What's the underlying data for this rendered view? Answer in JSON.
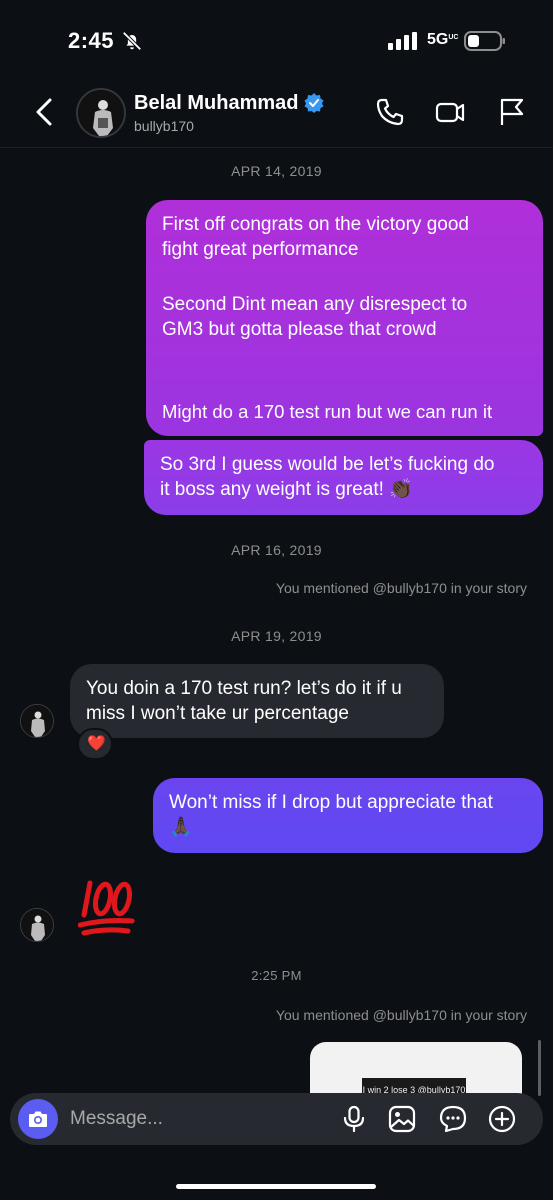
{
  "status_bar": {
    "time": "2:45",
    "network": "5G",
    "network_suffix": "UC"
  },
  "header": {
    "name": "Belal Muhammad",
    "handle": "bullyb170",
    "icons": [
      "back-icon",
      "verified-badge-icon",
      "phone-icon",
      "video-icon",
      "flag-icon"
    ]
  },
  "conversation": {
    "date1": "APR 14, 2019",
    "out1_line1": "First off congrats on the victory good",
    "out1_line2": "fight great performance",
    "out1_line3": "Second Dint mean any disrespect to",
    "out1_line4": "GM3 but gotta please that crowd",
    "out1_line5": "Might do a 170 test run but we can run it",
    "out2_line1": "So 3rd I guess would be let’s fucking do",
    "out2_line2": "it boss any weight is great! 👏🏿",
    "date2": "APR 16, 2019",
    "mention1": "You mentioned @bullyb170 in your story",
    "date3": "APR 19, 2019",
    "in1_line1": "You doin a 170 test run? let’s do it if u",
    "in1_line2": "miss I won’t take ur percentage",
    "reaction": "❤️",
    "out3_line1": "Won’t miss if I drop but appreciate that",
    "out3_line2": "🙏🏿",
    "in2_emoji": "💯",
    "time_label": "2:25 PM",
    "mention2": "You mentioned @bullyb170 in your story",
    "story_text": "I win 2 lose 3 @bullyb170"
  },
  "composer": {
    "placeholder": "Message...",
    "icons": [
      "camera-icon",
      "microphone-icon",
      "gallery-icon",
      "sticker-chat-icon",
      "plus-icon"
    ]
  },
  "colors": {
    "background": "#0c1014",
    "incoming_bubble": "#262a30",
    "outgoing_gradient_top": "#b02fd9",
    "outgoing_gradient_bottom": "#5c4df2",
    "camera_button": "#5b5cf2",
    "verified": "#3897f0"
  }
}
